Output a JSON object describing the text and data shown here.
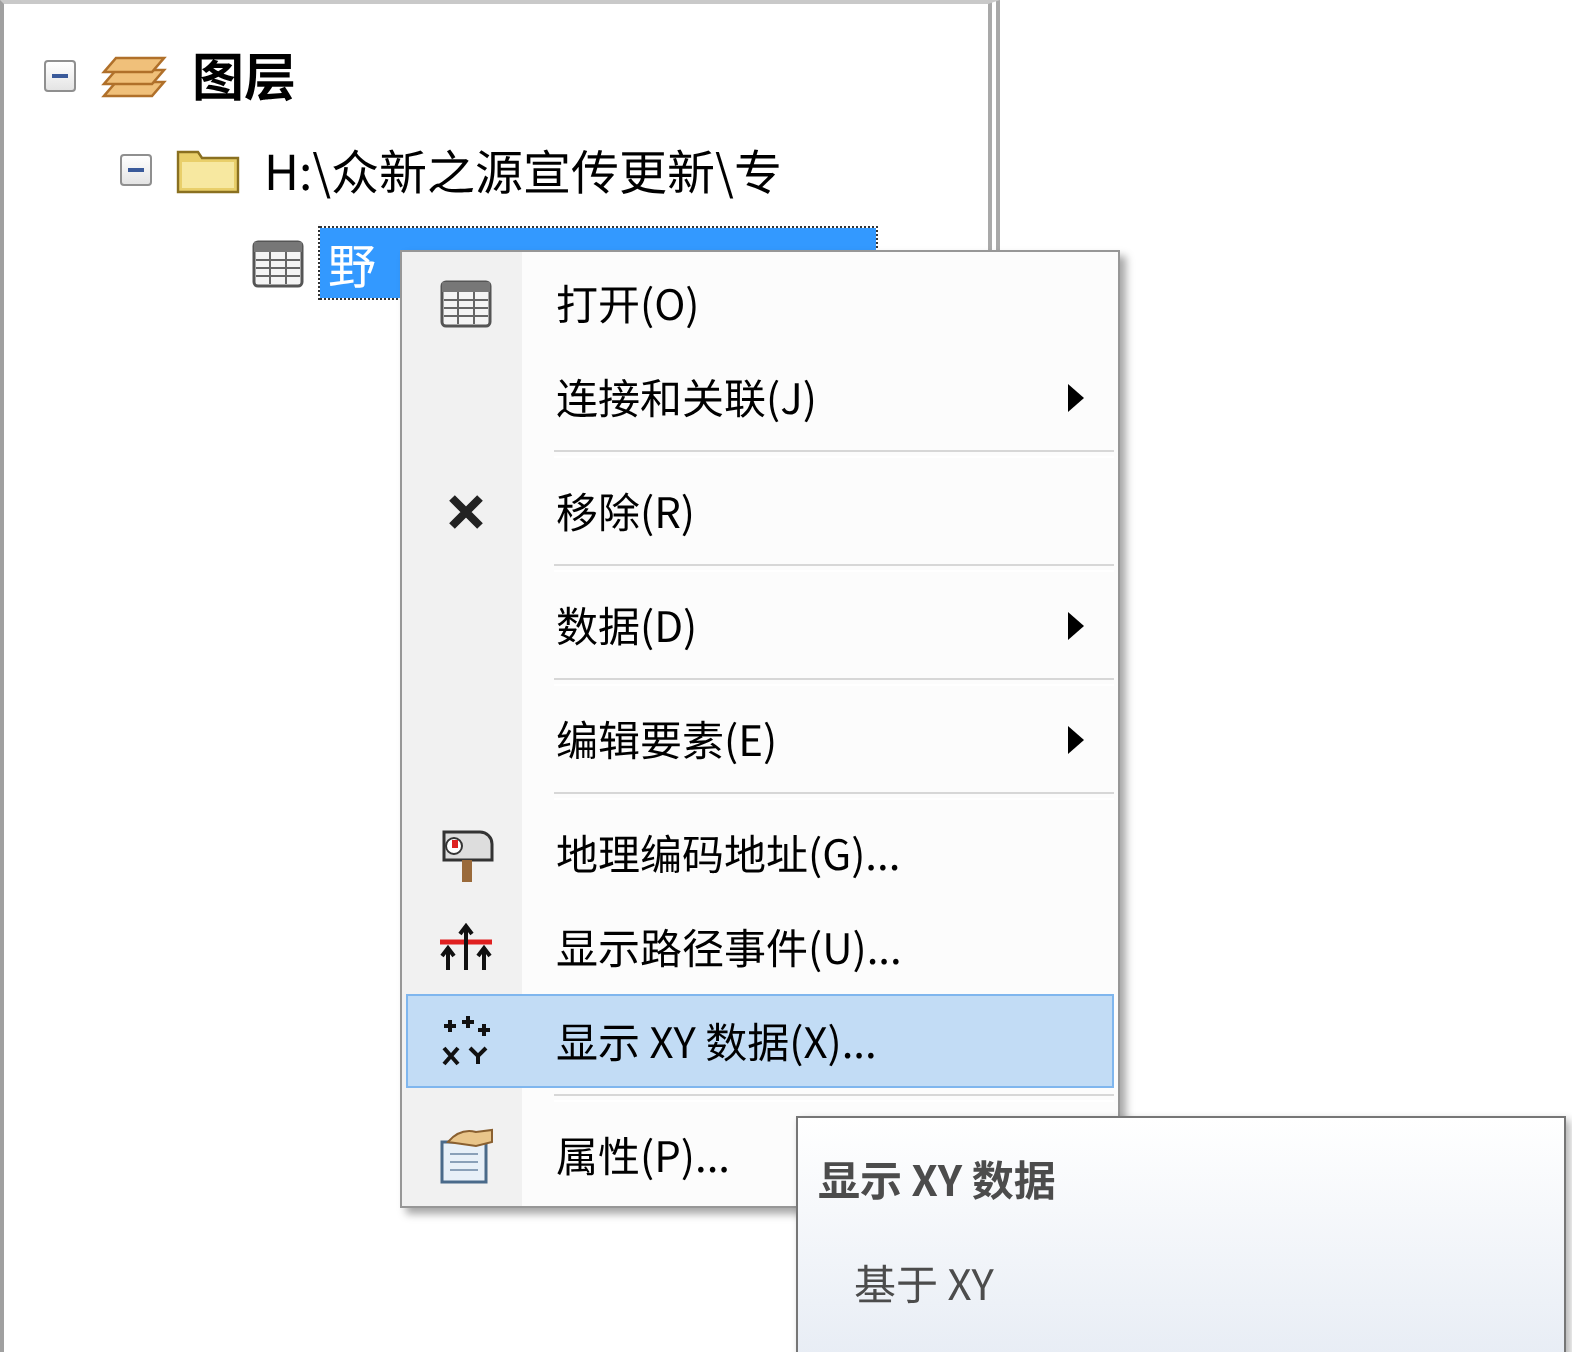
{
  "tree": [
    {
      "label": "图层",
      "kind": "layers",
      "expanded": true,
      "selected": false,
      "children": [
        {
          "label": "H:\\众新之源宣传更新\\专",
          "kind": "folder",
          "expanded": true,
          "selected": false,
          "children": [
            {
              "label": "野",
              "kind": "table",
              "selected": true
            }
          ]
        }
      ]
    }
  ],
  "context_menu": {
    "items": [
      {
        "kind": "table",
        "label": "打开(O)",
        "selected": false
      },
      {
        "kind": "plain",
        "label": "连接和关联(J)",
        "submenu": true,
        "selected": false
      },
      {
        "kind": "separator"
      },
      {
        "kind": "remove",
        "label": "移除(R)",
        "selected": false
      },
      {
        "kind": "separator"
      },
      {
        "kind": "plain",
        "label": "数据(D)",
        "submenu": true,
        "selected": false
      },
      {
        "kind": "separator"
      },
      {
        "kind": "plain",
        "label": "编辑要素(E)",
        "submenu": true,
        "selected": false
      },
      {
        "kind": "separator"
      },
      {
        "kind": "geocode",
        "label": "地理编码地址(G)...",
        "selected": false
      },
      {
        "kind": "route",
        "label": "显示路径事件(U)...",
        "selected": false
      },
      {
        "kind": "xy",
        "label": "显示 XY 数据(X)...",
        "selected": true
      },
      {
        "kind": "separator"
      },
      {
        "kind": "properties",
        "label": "属性(P)...",
        "selected": false
      }
    ]
  },
  "tooltip": {
    "title": "显示 XY 数据",
    "body": "基于 XY"
  }
}
